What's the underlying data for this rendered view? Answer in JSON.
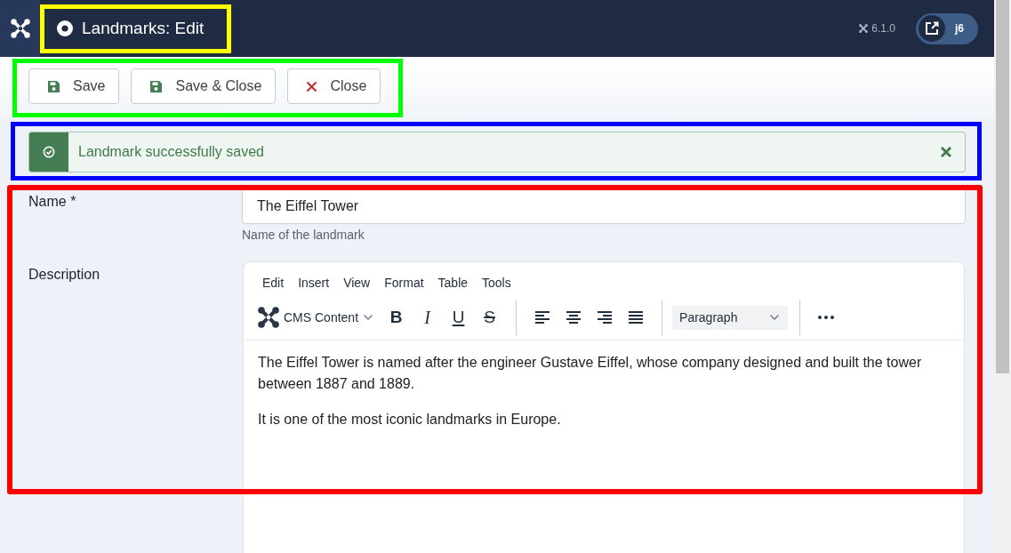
{
  "header": {
    "title": "Landmarks: Edit",
    "version": "6.1.0",
    "site_link": "j6"
  },
  "toolbar": {
    "buttons": [
      {
        "label": "Save",
        "kind": "save"
      },
      {
        "label": "Save & Close",
        "kind": "save"
      },
      {
        "label": "Close",
        "kind": "close"
      }
    ]
  },
  "alert": {
    "message": "Landmark successfully saved"
  },
  "form": {
    "name": {
      "label": "Name *",
      "value": "The Eiffel Tower",
      "hint": "Name of the landmark"
    },
    "description": {
      "label": "Description",
      "editor": {
        "menu": [
          "Edit",
          "Insert",
          "View",
          "Format",
          "Table",
          "Tools"
        ],
        "content_source": "CMS Content",
        "format_buttons": [
          {
            "glyph": "B",
            "kind": "bold"
          },
          {
            "glyph": "I",
            "kind": "italic"
          },
          {
            "glyph": "U",
            "kind": "underline"
          },
          {
            "glyph": "S",
            "kind": "strikethrough"
          }
        ],
        "block_format": "Paragraph",
        "paragraphs": [
          "The Eiffel Tower is named after the engineer Gustave Eiffel, whose company designed and built the tower between 1887 and 1889.",
          "It is one of the most iconic landmarks in Europe."
        ]
      }
    }
  }
}
